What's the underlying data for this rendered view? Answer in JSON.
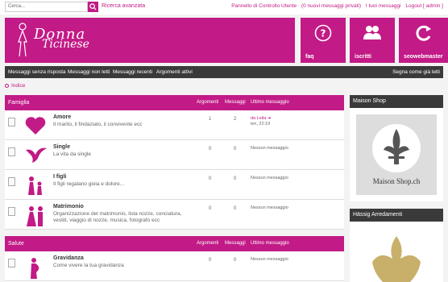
{
  "top": {
    "search_placeholder": "Cerca...",
    "advanced_search": "Ricerca avanzata",
    "user_panel": "Pannello di Controllo Utente",
    "private_messages": "(0 nuovi messaggi privati)",
    "your_messages": "I tuoi messaggi",
    "logout": "Logout [ admin ]"
  },
  "header": {
    "logo_line1": "Donna",
    "logo_line2": "Ticinese",
    "tiles": [
      {
        "label": "faq",
        "icon": "question-icon"
      },
      {
        "label": "iscritti",
        "icon": "users-icon"
      },
      {
        "label": "seowebmaster",
        "icon": "refresh-icon"
      }
    ]
  },
  "nav": {
    "items": [
      "Messaggi senza risposta",
      "Messaggi non letti",
      "Messaggi recenti",
      "Argomenti attivi"
    ],
    "mark_read": "Segna come già letti"
  },
  "breadcrumb": {
    "index": "Indice"
  },
  "columns": {
    "topics": "Argomenti",
    "posts": "Messaggi",
    "last": "Ultimo messaggio"
  },
  "sections": [
    {
      "name": "Famiglia",
      "forums": [
        {
          "title": "Amore",
          "desc": "Il marito, il findaziato, il convivente ecc",
          "topics": "1",
          "posts": "2",
          "last_by": "da Leila",
          "last_time": "ieri, 22:19",
          "icon": "heart-icon"
        },
        {
          "title": "Single",
          "desc": "La vita da single",
          "topics": "0",
          "posts": "0",
          "last_none": "Nessun messaggio",
          "icon": "bird-icon"
        },
        {
          "title": "I figli",
          "desc": "Il figli regalano gioia e dolore...",
          "topics": "0",
          "posts": "0",
          "last_none": "Nessun messaggio",
          "icon": "family-icon"
        },
        {
          "title": "Matrimonio",
          "desc": "Organizzazione del matrimonio, lista nozze, conciatura, vestiti, viaggio di nozze, musica, fotografo ecc",
          "topics": "0",
          "posts": "0",
          "last_none": "Nessun messaggio",
          "icon": "wedding-icon"
        }
      ]
    },
    {
      "name": "Salute",
      "forums": [
        {
          "title": "Gravidanza",
          "desc": "Come vivere la tua gravidanza",
          "topics": "0",
          "posts": "0",
          "last_none": "Nessun messaggio",
          "icon": "pregnancy-icon"
        }
      ]
    }
  ],
  "sidebar": {
    "maison_title": "Maison Shop",
    "maison_logo_text": "Maison Shop.ch",
    "hassig_title": "Hässig Arredamenti"
  },
  "colors": {
    "accent": "#c21a86",
    "dark": "#3a3a3a"
  }
}
